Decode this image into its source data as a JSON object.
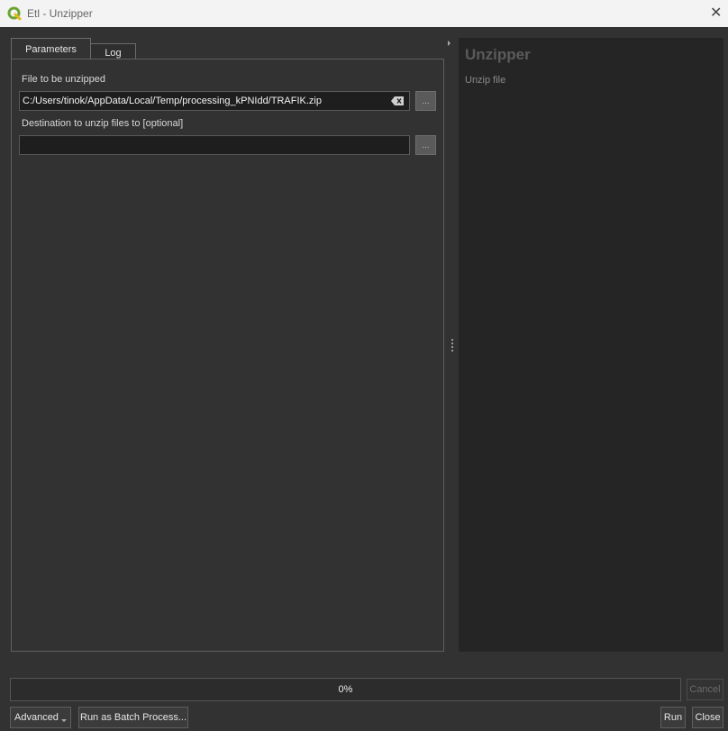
{
  "window": {
    "title": "Etl - Unzipper",
    "close_glyph": "✕"
  },
  "tabs": [
    {
      "label": "Parameters"
    },
    {
      "label": "Log"
    }
  ],
  "parameters": {
    "file": {
      "label": "File to be unzipped",
      "value": "C:/Users/tinok/AppData/Local/Temp/processing_kPNIdd/TRAFIK.zip",
      "browse_label": "..."
    },
    "destination": {
      "label": "Destination to unzip files to [optional]",
      "value": "",
      "browse_label": "..."
    }
  },
  "help": {
    "title": "Unzipper",
    "description": "Unzip file"
  },
  "progress": {
    "value": 0,
    "text": "0%"
  },
  "buttons": {
    "cancel": "Cancel",
    "advanced": "Advanced",
    "batch": "Run as Batch Process...",
    "run": "Run",
    "close": "Close"
  },
  "colors": {
    "app_icon": "#5e9e2b",
    "background": "#323232",
    "help_background": "#252525"
  }
}
